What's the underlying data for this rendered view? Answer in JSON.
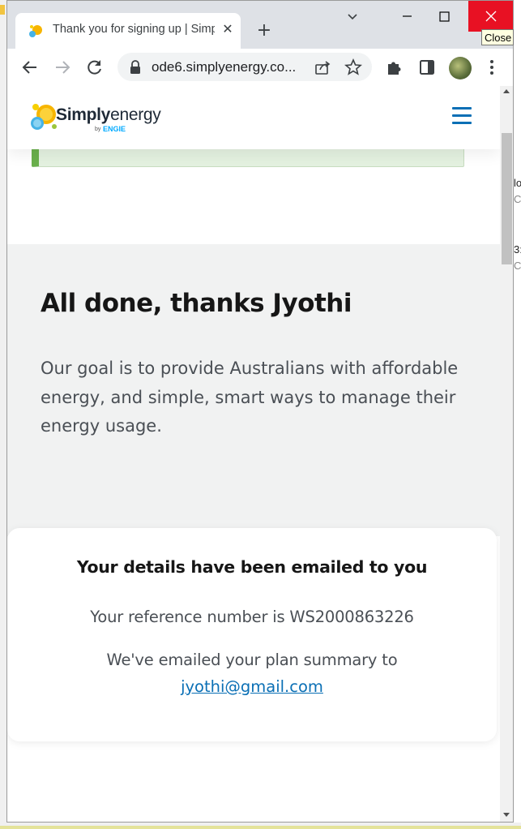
{
  "browser": {
    "tab_title": "Thank you for signing up | Simply Energy",
    "url": "ode6.simplyenergy.co...",
    "tooltip": "Close",
    "tab_close_glyph": "✕",
    "new_tab_glyph": "+"
  },
  "background_window": {
    "lines": [
      {
        "text": "lo",
        "style": "dark"
      },
      {
        "text": "C",
        "style": "gray"
      },
      {
        "text": "3:",
        "style": "dark"
      },
      {
        "text": "C",
        "style": "gray"
      }
    ]
  },
  "site": {
    "logo": {
      "brand_bold": "Simply",
      "brand_light": "energy",
      "by": "by",
      "engie": "ENGIE"
    },
    "heading": "All done, thanks Jyothi",
    "goal_text": "Our goal is to provide Australians with affordable energy, and simple, smart ways to manage their energy usage.",
    "card": {
      "title": "Your details have been emailed to you",
      "reference_text": "Your reference number is WS2000863226",
      "email_intro": "We've emailed your plan summary to",
      "email": "jyothi@gmail.com"
    }
  },
  "colors": {
    "accent_blue": "#0a6fb5",
    "close_red": "#e81123",
    "success_green": "#6ab04c",
    "section_gray": "#f1f2f2"
  }
}
